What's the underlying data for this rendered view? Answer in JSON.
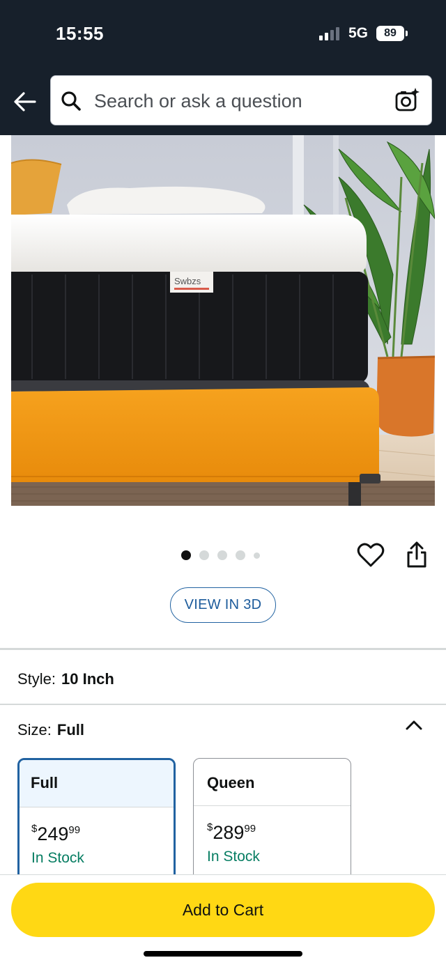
{
  "status_bar": {
    "time": "15:55",
    "network": "5G",
    "battery": "89"
  },
  "search": {
    "placeholder": "Search or ask a question"
  },
  "product_image": {
    "brand_label": "Swbzs",
    "colors": {
      "base": "#f39311",
      "mattress_side": "#17181b",
      "topper": "#f1efec"
    }
  },
  "carousel": {
    "total": 5,
    "active_index": 0
  },
  "view3d": {
    "label": "VIEW IN 3D"
  },
  "style": {
    "label": "Style:",
    "value": "10 Inch"
  },
  "size": {
    "label": "Size:",
    "value": "Full",
    "options": [
      {
        "name": "Full",
        "price_symbol": "$",
        "price_whole": "249",
        "price_fraction": "99",
        "stock": "In Stock",
        "selected": true
      },
      {
        "name": "Queen",
        "price_symbol": "$",
        "price_whole": "289",
        "price_fraction": "99",
        "stock": "In Stock",
        "selected": false
      }
    ]
  },
  "cart": {
    "label": "Add to Cart"
  },
  "colors": {
    "header_bg": "#17202b",
    "accent_blue": "#2162a1",
    "cart_yellow": "#ffd814",
    "stock_green": "#067d62"
  }
}
